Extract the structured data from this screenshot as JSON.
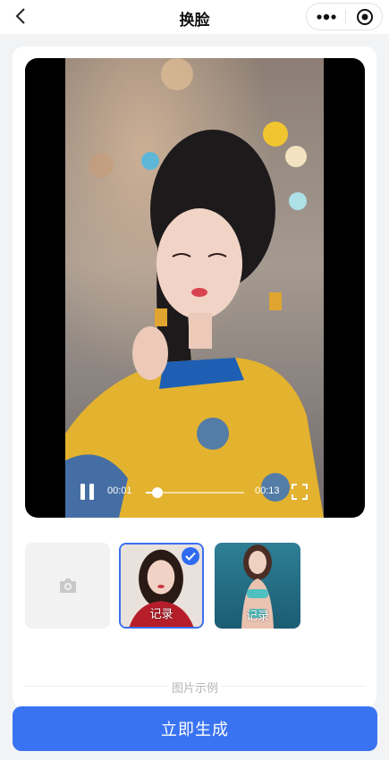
{
  "nav": {
    "title": "换脸",
    "back_icon": "chevron-left-icon",
    "more_icon": "more-dots-icon",
    "close_icon": "target-close-icon"
  },
  "video": {
    "current_time": "00:01",
    "duration": "00:13",
    "progress": 0.12,
    "state": "playing"
  },
  "faces": [
    {
      "type": "upload",
      "icon": "camera-icon"
    },
    {
      "type": "example",
      "label": "记录",
      "selected": true
    },
    {
      "type": "example",
      "label": "记录",
      "selected": false
    }
  ],
  "sample_caption": "图片示例",
  "generate_button": "立即生成",
  "colors": {
    "accent": "#3a73f2",
    "selected_border": "#3a6ff0",
    "background": "#f2f3f5"
  }
}
